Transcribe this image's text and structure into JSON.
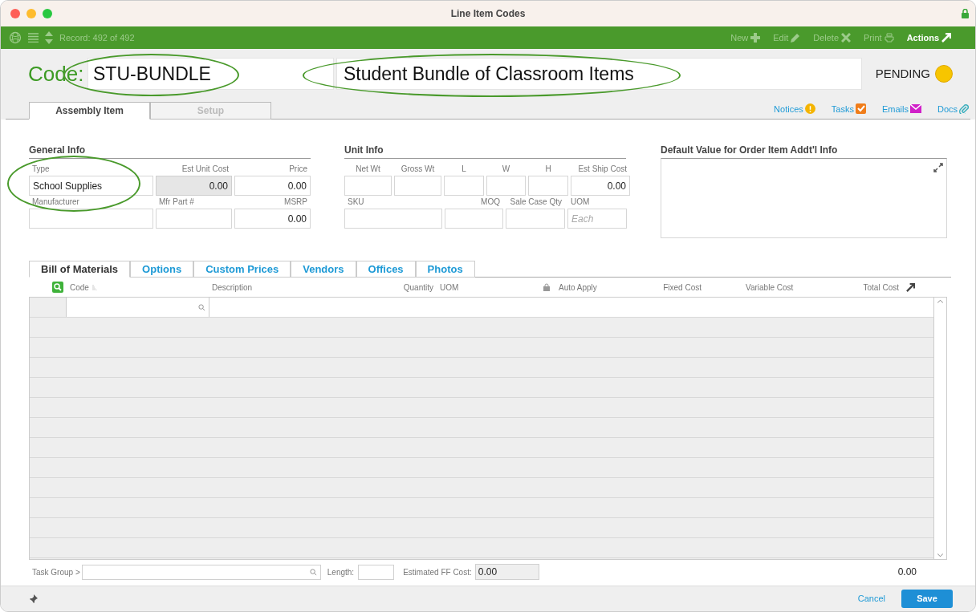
{
  "window": {
    "title": "Line Item Codes"
  },
  "toolbar": {
    "record": "Record: 492 of 492",
    "actions": [
      {
        "label": "New",
        "kind": "new",
        "disabled": true
      },
      {
        "label": "Edit",
        "kind": "edit",
        "disabled": true
      },
      {
        "label": "Delete",
        "kind": "delete",
        "disabled": true
      },
      {
        "label": "Print",
        "kind": "print",
        "disabled": true
      },
      {
        "label": "Actions",
        "kind": "actions",
        "disabled": false
      }
    ]
  },
  "header": {
    "code_label": "Code:",
    "code": "STU-BUNDLE",
    "description": "Student Bundle of Classroom Items",
    "status": "PENDING"
  },
  "tabs": [
    {
      "label": "Assembly Item",
      "selected": true
    },
    {
      "label": "Setup",
      "selected": false
    }
  ],
  "links": [
    {
      "label": "Notices",
      "kind": "notices"
    },
    {
      "label": "Tasks",
      "kind": "tasks"
    },
    {
      "label": "Emails",
      "kind": "emails"
    },
    {
      "label": "Docs",
      "kind": "docs"
    }
  ],
  "general_info": {
    "title": "General Info",
    "fields": [
      {
        "label": "Type",
        "value": "School Supplies",
        "readonly": false
      },
      {
        "label": "Est Unit Cost",
        "value": "0.00",
        "readonly": true
      },
      {
        "label": "Price",
        "value": "0.00",
        "readonly": false
      },
      {
        "label": "Manufacturer",
        "readonly": false
      },
      {
        "label": "Mfr Part #",
        "readonly": false
      },
      {
        "label": "MSRP",
        "value": "0.00",
        "readonly": false
      }
    ]
  },
  "unit_info": {
    "title": "Unit Info",
    "fields": [
      {
        "label": "Net Wt",
        "readonly": false
      },
      {
        "label": "Gross Wt",
        "readonly": false
      },
      {
        "label": "L",
        "readonly": false
      },
      {
        "label": "W",
        "readonly": false
      },
      {
        "label": "H",
        "readonly": false
      },
      {
        "label": "Est Ship Cost",
        "value": "0.00",
        "readonly": false
      },
      {
        "label": "SKU",
        "readonly": false
      },
      {
        "label": "MOQ",
        "readonly": false
      },
      {
        "label": "Sale Case Qty",
        "readonly": false
      },
      {
        "label": "UOM",
        "placeholder": "Each",
        "readonly": false
      }
    ]
  },
  "default_info": {
    "title": "Default Value for Order Item Addt'l Info"
  },
  "sub_tabs": [
    {
      "label": "Bill of Materials",
      "selected": true
    },
    {
      "label": "Options",
      "selected": false
    },
    {
      "label": "Custom Prices",
      "selected": false
    },
    {
      "label": "Vendors",
      "selected": false
    },
    {
      "label": "Offices",
      "selected": false
    },
    {
      "label": "Photos",
      "selected": false
    }
  ],
  "table": {
    "columns": [
      "Code",
      "Description",
      "Quantity",
      "UOM",
      "Auto Apply",
      "Fixed Cost",
      "Variable Cost",
      "Total Cost"
    ]
  },
  "footer_fields": {
    "task_group_label": "Task Group >",
    "length_label": "Length:",
    "ff_cost_label": "Estimated FF Cost:",
    "ff_cost": "0.00",
    "total": "0.00"
  },
  "buttons": [
    {
      "label": "Cancel",
      "kind": "link"
    },
    {
      "label": "Save",
      "kind": "primary"
    }
  ]
}
